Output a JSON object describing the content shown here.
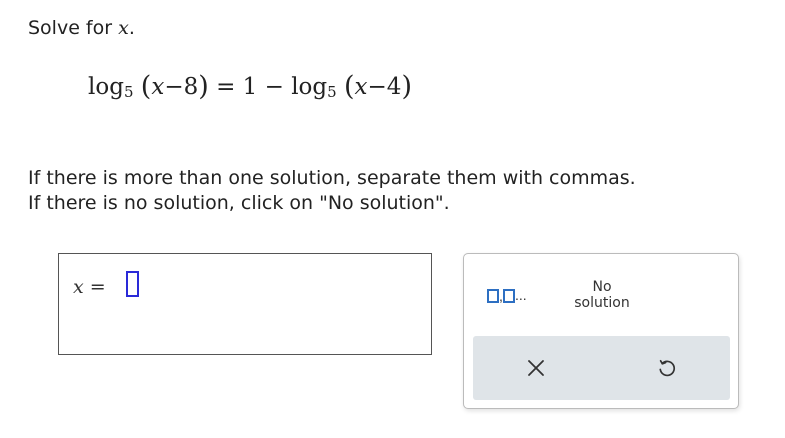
{
  "prompt": {
    "text": "Solve for ",
    "variable": "x",
    "period": "."
  },
  "equation": {
    "log": "log",
    "base": "5",
    "var": "x",
    "left_inner": "−8",
    "equals_one_minus": " = 1 − ",
    "right_inner": "−4",
    "open": "(",
    "close": ")"
  },
  "instructions": {
    "line1": "If there is more than one solution, separate them with commas.",
    "line2": "If there is no solution, click on \"No solution\"."
  },
  "answer": {
    "variable": "x",
    "equals": " = ",
    "value": ""
  },
  "palette": {
    "multi_comma": ",",
    "multi_dots": "...",
    "no_solution_line1": "No",
    "no_solution_line2": "solution"
  },
  "colors": {
    "accent_blue": "#2d6fc2",
    "field_border": "#2a2ad8",
    "action_bar": "#dfe4e8"
  }
}
